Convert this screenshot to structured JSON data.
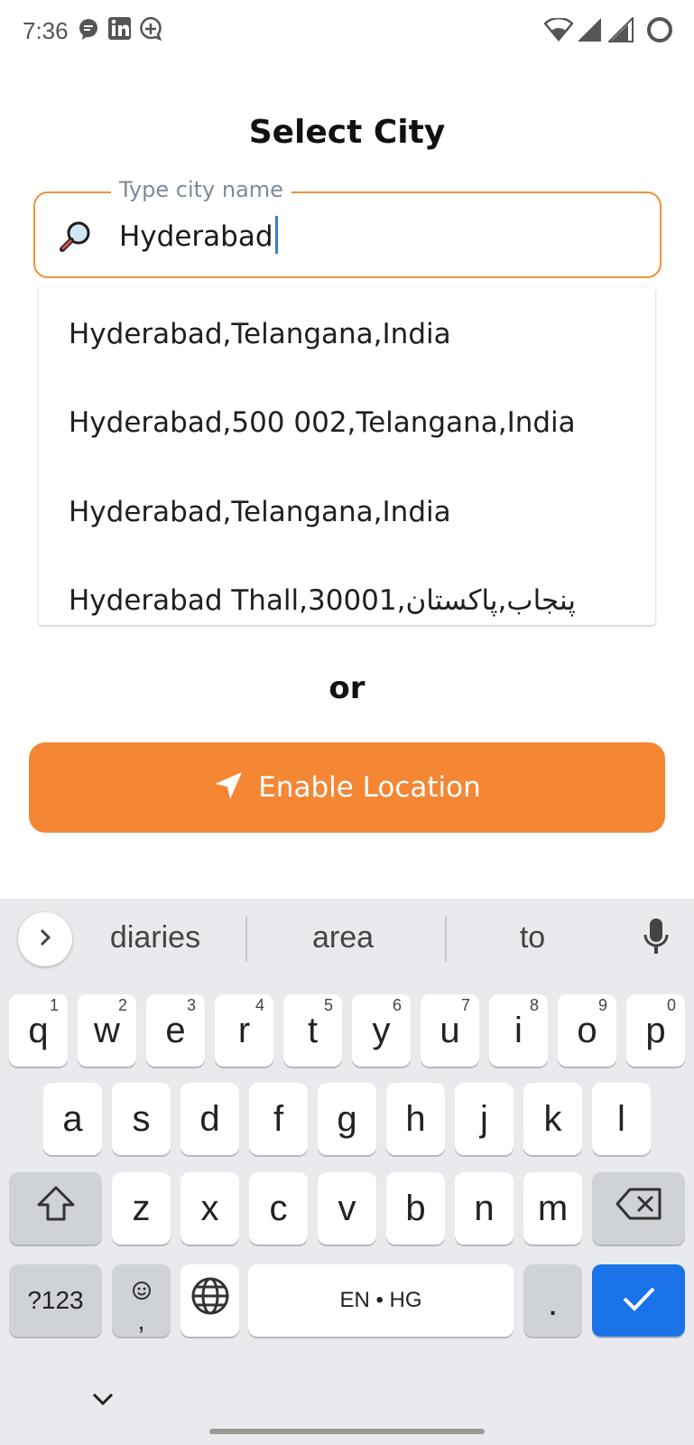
{
  "status_bar": {
    "time": "7:36",
    "left_icons": [
      "message-bubble-icon",
      "linkedin-icon",
      "chat-plus-icon"
    ],
    "right_icons": [
      "wifi-icon",
      "signal-icon",
      "signal-icon",
      "battery-circle-icon"
    ]
  },
  "page": {
    "title": "Select City",
    "or_text": "or"
  },
  "search": {
    "label": "Type city name",
    "value": "Hyderabad",
    "icon": "magnifier-icon",
    "accent_color": "#f0913a"
  },
  "suggestions": [
    "Hyderabad,Telangana,India",
    "Hyderabad,500 002,Telangana,India",
    "Hyderabad,Telangana,India",
    "Hyderabad Thall,30001,پنجاب,پاکستان"
  ],
  "enable_location": {
    "label": "Enable Location",
    "icon": "navigation-arrow-icon",
    "color": "#f48634"
  },
  "keyboard": {
    "word_suggestions": [
      "diaries",
      "area",
      "to"
    ],
    "row1": [
      {
        "k": "q",
        "h": "1"
      },
      {
        "k": "w",
        "h": "2"
      },
      {
        "k": "e",
        "h": "3"
      },
      {
        "k": "r",
        "h": "4"
      },
      {
        "k": "t",
        "h": "5"
      },
      {
        "k": "y",
        "h": "6"
      },
      {
        "k": "u",
        "h": "7"
      },
      {
        "k": "i",
        "h": "8"
      },
      {
        "k": "o",
        "h": "9"
      },
      {
        "k": "p",
        "h": "0"
      }
    ],
    "row2": [
      "a",
      "s",
      "d",
      "f",
      "g",
      "h",
      "j",
      "k",
      "l"
    ],
    "row3": [
      "z",
      "x",
      "c",
      "v",
      "b",
      "n",
      "m"
    ],
    "symbols_label": "?123",
    "comma_label": ",",
    "space_label": "EN • HG",
    "period_label": ".",
    "enter_color": "#1a73e8"
  }
}
